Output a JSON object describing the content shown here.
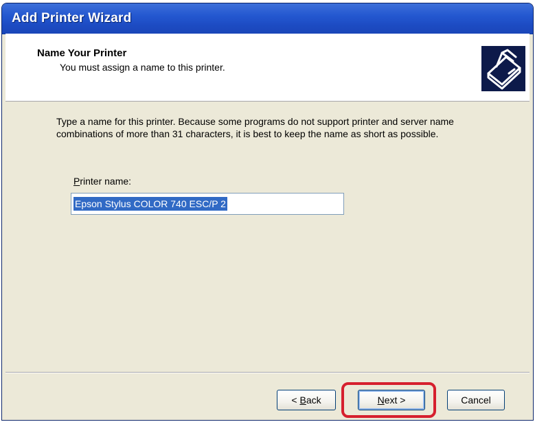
{
  "window": {
    "title": "Add Printer Wizard"
  },
  "header": {
    "title": "Name Your Printer",
    "subtitle": "You must assign a name to this printer.",
    "icon": "printer-icon"
  },
  "body": {
    "description": "Type a name for this printer. Because some programs do not support printer and server name combinations of more than 31 characters, it is best to keep the name as short as possible.",
    "field_label_accel": "P",
    "field_label_rest": "rinter name:",
    "printer_name_value": "Epson Stylus COLOR 740 ESC/P 2"
  },
  "buttons": {
    "back_prefix": "< ",
    "back_accel": "B",
    "back_rest": "ack",
    "next_accel": "N",
    "next_rest": "ext >",
    "cancel": "Cancel"
  },
  "colors": {
    "titlebar": "#2458d0",
    "dialog_bg": "#ece9d8",
    "selection": "#316ac5",
    "highlight_ring": "#d6202e"
  }
}
